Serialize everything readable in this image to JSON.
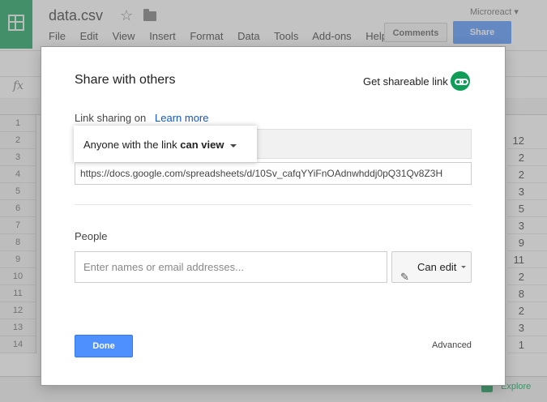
{
  "app": {
    "doc_title": "data.csv",
    "menu": [
      "File",
      "Edit",
      "View",
      "Insert",
      "Format",
      "Data",
      "Tools",
      "Add-ons",
      "Help"
    ],
    "account": "Microreact ▾",
    "comments_label": "Comments",
    "share_label": "Share",
    "fx_label": "fx",
    "row_numbers": [
      "1",
      "2",
      "3",
      "4",
      "5",
      "6",
      "7",
      "8",
      "9",
      "10",
      "11",
      "12",
      "13",
      "14"
    ],
    "visible_column_values": [
      "12",
      "2",
      "2",
      "3",
      "5",
      "3",
      "9",
      "11",
      "2",
      "8",
      "2",
      "3",
      "1"
    ],
    "explore_label": "Explore"
  },
  "dialog": {
    "title": "Share with others",
    "get_link_label": "Get shareable link",
    "sharing_status": "Link sharing on",
    "learn_more": "Learn more",
    "access_prefix": "Anyone with the link ",
    "access_level": "can view",
    "share_url": "https://docs.google.com/spreadsheets/d/10Sv_cafqYYiFnOAdnwhddj0pQ31Qv8Z3H",
    "people_label": "People",
    "people_placeholder": "Enter names or email addresses...",
    "permission_label": "Can edit",
    "done_label": "Done",
    "advanced_label": "Advanced"
  }
}
